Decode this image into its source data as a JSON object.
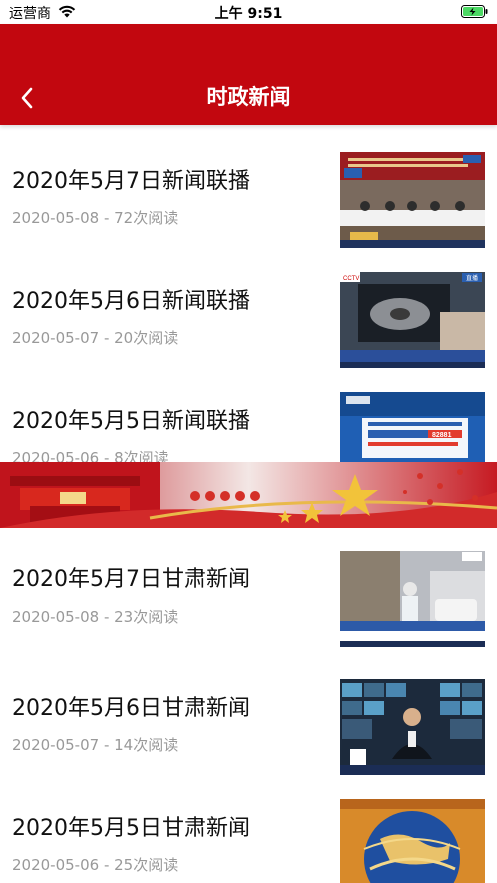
{
  "status": {
    "carrier": "运营商",
    "time": "上午 9:51"
  },
  "nav": {
    "title": "时政新闻",
    "back_icon": "chevron-left-icon"
  },
  "colors": {
    "brand": "#c2070f",
    "title_text": "#111111",
    "meta_text": "#999999"
  },
  "news": [
    {
      "title": "2020年5月7日新闻联播",
      "date": "2020-05-08",
      "reads": "72次阅读",
      "meta": "2020-05-08 - 72次阅读"
    },
    {
      "title": "2020年5月6日新闻联播",
      "date": "2020-05-07",
      "reads": "20次阅读",
      "meta": "2020-05-07 - 20次阅读"
    },
    {
      "title": "2020年5月5日新闻联播",
      "date": "2020-05-06",
      "reads": "8次阅读",
      "meta": "2020-05-06 - 8次阅读"
    },
    {
      "title": "2020年5月7日甘肃新闻",
      "date": "2020-05-08",
      "reads": "23次阅读",
      "meta": "2020-05-08 - 23次阅读"
    },
    {
      "title": "2020年5月6日甘肃新闻",
      "date": "2020-05-07",
      "reads": "14次阅读",
      "meta": "2020-05-07 - 14次阅读"
    },
    {
      "title": "2020年5月5日甘肃新闻",
      "date": "2020-05-06",
      "reads": "25次阅读",
      "meta": "2020-05-06 - 25次阅读"
    }
  ],
  "thumbnails": {
    "ticker_1": "82881",
    "badge_cctv": "CCTV",
    "badge_live": "直播"
  }
}
